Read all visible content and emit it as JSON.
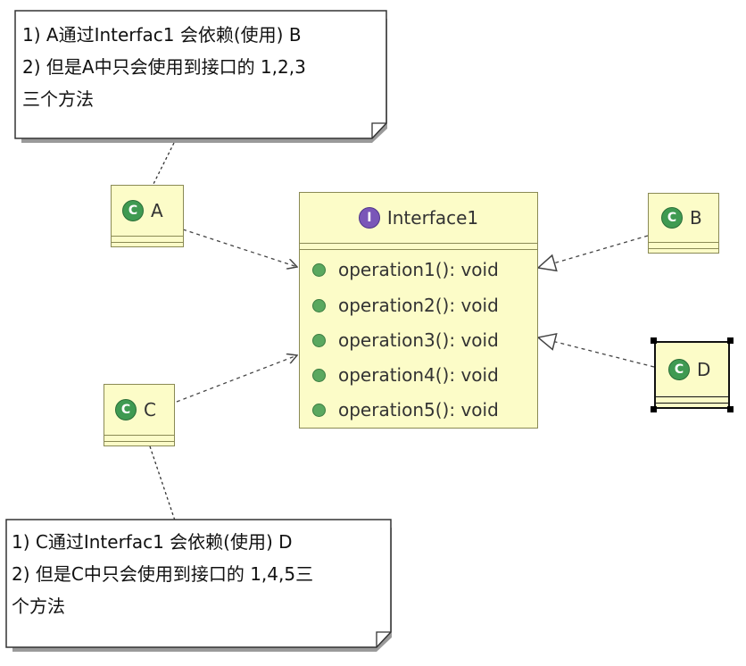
{
  "notes": {
    "a": {
      "lines": [
        "1) A通过Interfac1 会依赖(使用) B",
        "2) 但是A中只会使用到接口的 1,2,3",
        "三个方法"
      ]
    },
    "c": {
      "lines": [
        "1) C通过Interfac1 会依赖(使用) D",
        "2) 但是C中只会使用到接口的 1,4,5三",
        "个方法"
      ]
    }
  },
  "classes": {
    "a": {
      "name": "A",
      "icon": "class-icon"
    },
    "b": {
      "name": "B",
      "icon": "class-icon"
    },
    "c": {
      "name": "C",
      "icon": "class-icon"
    },
    "d": {
      "name": "D",
      "icon": "class-icon",
      "selected": true
    }
  },
  "interface": {
    "name": "Interface1",
    "icon": "interface-icon",
    "operations": [
      "operation1(): void",
      "operation2(): void",
      "operation3(): void",
      "operation4(): void",
      "operation5(): void"
    ]
  },
  "colors": {
    "class_fill": "#fcfcc8",
    "class_border": "#8a8a55",
    "class_badge": "#3f9a52",
    "interface_badge": "#7a56b8",
    "operation_dot": "#5aa85f"
  }
}
